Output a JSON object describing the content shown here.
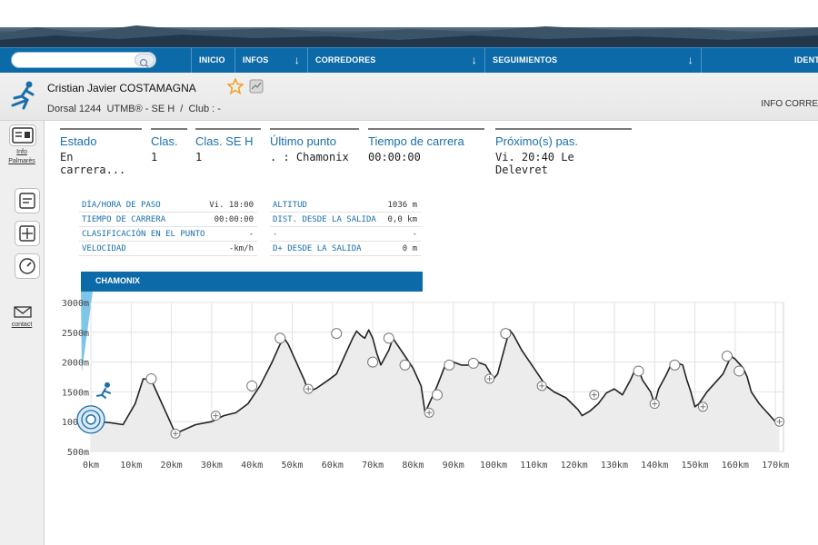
{
  "nav": {
    "search_placeholder": "",
    "items": [
      {
        "label": "INICIO"
      },
      {
        "label": "INFOS",
        "arrow": "↓"
      },
      {
        "label": "CORREDORES",
        "arrow": "↓"
      },
      {
        "label": "SEGUIMIENTOS",
        "arrow": "↓"
      },
      {
        "label": "IDENT"
      }
    ]
  },
  "runner": {
    "name": "Cristian Javier COSTAMAGNA",
    "bib": "Dorsal 1244",
    "race": "UTMB® - SE H",
    "separator": "/",
    "club": "Club : -",
    "info_link": "INFO CORRE"
  },
  "sidebar": {
    "info_label_1": "Info",
    "info_label_2": "Palmarès",
    "contact_label": "contact"
  },
  "status": {
    "columns": [
      {
        "header": "Estado",
        "value": "En carrera..."
      },
      {
        "header": "Clas.",
        "value": "1"
      },
      {
        "header": "Clas. SE H",
        "value": "1"
      },
      {
        "header": "Último punto",
        "value": ". :  Chamonix"
      },
      {
        "header": "Tiempo de carrera",
        "value": "00:00:00"
      },
      {
        "header": "Próximo(s) pas.",
        "value": "Vi. 20:40  Le Delevret"
      }
    ]
  },
  "detail": {
    "left": [
      {
        "k": "DÍA/HORA DE PASO",
        "v": "Vi. 18:00"
      },
      {
        "k": "TIEMPO DE CARRERA",
        "v": "00:00:00"
      },
      {
        "k": "CLASIFICACIÓN EN EL PUNTO",
        "v": "-"
      },
      {
        "k": "VELOCIDAD",
        "v": "-km/h"
      }
    ],
    "right": [
      {
        "k": "ALTITUD",
        "v": "1036 m"
      },
      {
        "k": "DIST. DESDE LA SALIDA",
        "v": "0,0 km"
      },
      {
        "k": "-",
        "v": "-"
      },
      {
        "k": "D+ DESDE LA SALIDA",
        "v": "0 m"
      }
    ]
  },
  "place": "CHAMONIX",
  "colors": {
    "nav": "#0d6aa8",
    "accent": "#1a6fa8",
    "star": "#f0a020"
  },
  "chart_data": {
    "type": "area",
    "xlabel": "",
    "ylabel": "",
    "x_ticks": [
      "0km",
      "10km",
      "20km",
      "30km",
      "40km",
      "50km",
      "60km",
      "70km",
      "80km",
      "90km",
      "100km",
      "110km",
      "120km",
      "130km",
      "140km",
      "150km",
      "160km",
      "170km"
    ],
    "y_ticks": [
      "500m",
      "1000m",
      "1500m",
      "2000m",
      "2500m",
      "3000m"
    ],
    "xlim": [
      0,
      172
    ],
    "ylim": [
      500,
      3000
    ],
    "grid": true,
    "profile": [
      [
        0,
        1036
      ],
      [
        2,
        1000
      ],
      [
        5,
        980
      ],
      [
        8,
        950
      ],
      [
        11,
        1300
      ],
      [
        13,
        1720
      ],
      [
        15,
        1700
      ],
      [
        17,
        1400
      ],
      [
        19,
        1100
      ],
      [
        21,
        800
      ],
      [
        23,
        860
      ],
      [
        26,
        950
      ],
      [
        30,
        1000
      ],
      [
        33,
        1100
      ],
      [
        36,
        1150
      ],
      [
        39,
        1300
      ],
      [
        42,
        1600
      ],
      [
        45,
        2000
      ],
      [
        47,
        2300
      ],
      [
        48,
        2400
      ],
      [
        49,
        2300
      ],
      [
        51,
        2000
      ],
      [
        53,
        1700
      ],
      [
        54,
        1500
      ],
      [
        56,
        1560
      ],
      [
        59,
        1700
      ],
      [
        61,
        1800
      ],
      [
        63,
        2100
      ],
      [
        65,
        2400
      ],
      [
        66,
        2520
      ],
      [
        67,
        2450
      ],
      [
        68,
        2400
      ],
      [
        69,
        2540
      ],
      [
        70,
        2400
      ],
      [
        71,
        2150
      ],
      [
        72,
        1950
      ],
      [
        74,
        2200
      ],
      [
        75,
        2400
      ],
      [
        76,
        2300
      ],
      [
        78,
        2100
      ],
      [
        80,
        1900
      ],
      [
        82,
        1600
      ],
      [
        83,
        1150
      ],
      [
        84,
        1300
      ],
      [
        85,
        1450
      ],
      [
        86,
        1600
      ],
      [
        88,
        1950
      ],
      [
        90,
        2000
      ],
      [
        92,
        1950
      ],
      [
        94,
        1950
      ],
      [
        96,
        2000
      ],
      [
        98,
        1950
      ],
      [
        100,
        1720
      ],
      [
        101,
        1800
      ],
      [
        103,
        2300
      ],
      [
        104,
        2540
      ],
      [
        105,
        2450
      ],
      [
        107,
        2200
      ],
      [
        109,
        2000
      ],
      [
        111,
        1800
      ],
      [
        113,
        1600
      ],
      [
        115,
        1500
      ],
      [
        118,
        1400
      ],
      [
        121,
        1200
      ],
      [
        122,
        1100
      ],
      [
        124,
        1180
      ],
      [
        126,
        1300
      ],
      [
        128,
        1480
      ],
      [
        130,
        1550
      ],
      [
        132,
        1450
      ],
      [
        134,
        1700
      ],
      [
        135,
        1850
      ],
      [
        136,
        1870
      ],
      [
        137,
        1700
      ],
      [
        139,
        1500
      ],
      [
        140,
        1300
      ],
      [
        141,
        1550
      ],
      [
        143,
        1800
      ],
      [
        144,
        1950
      ],
      [
        145,
        2000
      ],
      [
        147,
        1950
      ],
      [
        148,
        1700
      ],
      [
        149,
        1500
      ],
      [
        150,
        1250
      ],
      [
        151,
        1300
      ],
      [
        153,
        1500
      ],
      [
        155,
        1650
      ],
      [
        157,
        1800
      ],
      [
        159,
        2100
      ],
      [
        160,
        2050
      ],
      [
        162,
        1900
      ],
      [
        163,
        1750
      ],
      [
        164,
        1500
      ],
      [
        166,
        1300
      ],
      [
        168,
        1150
      ],
      [
        170,
        1000
      ],
      [
        171,
        1000
      ]
    ],
    "points": [
      {
        "x": 15,
        "y": 1720,
        "kind": "summit"
      },
      {
        "x": 21,
        "y": 800,
        "kind": "pass"
      },
      {
        "x": 31,
        "y": 1100,
        "kind": "pass"
      },
      {
        "x": 40,
        "y": 1600,
        "kind": "summit"
      },
      {
        "x": 47,
        "y": 2400,
        "kind": "summit"
      },
      {
        "x": 54,
        "y": 1550,
        "kind": "pass"
      },
      {
        "x": 61,
        "y": 2480,
        "kind": "summit"
      },
      {
        "x": 70,
        "y": 2000,
        "kind": "summit"
      },
      {
        "x": 74,
        "y": 2400,
        "kind": "summit"
      },
      {
        "x": 78,
        "y": 1950,
        "kind": "summit"
      },
      {
        "x": 84,
        "y": 1150,
        "kind": "pass"
      },
      {
        "x": 86,
        "y": 1450,
        "kind": "summit"
      },
      {
        "x": 89,
        "y": 1950,
        "kind": "summit"
      },
      {
        "x": 95,
        "y": 1980,
        "kind": "summit"
      },
      {
        "x": 99,
        "y": 1720,
        "kind": "pass"
      },
      {
        "x": 103,
        "y": 2480,
        "kind": "summit"
      },
      {
        "x": 112,
        "y": 1600,
        "kind": "pass"
      },
      {
        "x": 125,
        "y": 1450,
        "kind": "pass"
      },
      {
        "x": 136,
        "y": 1850,
        "kind": "summit"
      },
      {
        "x": 140,
        "y": 1300,
        "kind": "pass"
      },
      {
        "x": 145,
        "y": 1950,
        "kind": "summit"
      },
      {
        "x": 152,
        "y": 1250,
        "kind": "pass"
      },
      {
        "x": 158,
        "y": 2100,
        "kind": "summit"
      },
      {
        "x": 161,
        "y": 1850,
        "kind": "summit"
      },
      {
        "x": 171,
        "y": 1000,
        "kind": "pass"
      }
    ],
    "runner": {
      "x": 0,
      "y": 1036
    }
  }
}
